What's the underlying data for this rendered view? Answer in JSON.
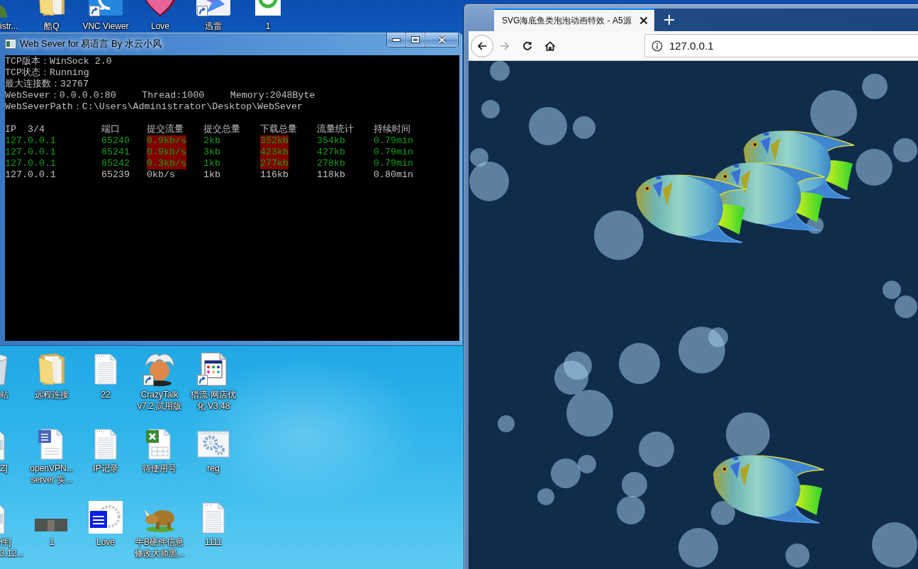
{
  "desktop": {
    "icons": [
      {
        "label": "istr...",
        "kind": "user",
        "shortcut": false
      },
      {
        "label": "酷Q",
        "kind": "folder",
        "shortcut": false
      },
      {
        "label": "VNC Viewer",
        "kind": "vnc",
        "shortcut": true
      },
      {
        "label": "Love",
        "kind": "heart",
        "shortcut": false
      },
      {
        "label": "迅雷",
        "kind": "bird",
        "shortcut": true
      },
      {
        "label": "1",
        "kind": "ring",
        "shortcut": false
      },
      {
        "label": "站",
        "kind": "bin",
        "shortcut": false
      },
      {
        "label": "远程连接",
        "kind": "folder",
        "shortcut": false
      },
      {
        "label": "22",
        "kind": "text",
        "shortcut": false
      },
      {
        "label": "CrazyTalk\nv7.2 試用版",
        "kind": "character",
        "shortcut": true
      },
      {
        "label": "猎流-网店优化 V3.48",
        "kind": "app",
        "shortcut": true
      },
      {
        "label": "Z]",
        "kind": "file",
        "shortcut": false
      },
      {
        "label": "openVPN...\nserver 实...",
        "kind": "word",
        "shortcut": false
      },
      {
        "label": "IP记录",
        "kind": "text",
        "shortcut": false
      },
      {
        "label": "待使用号",
        "kind": "sheet",
        "shortcut": false
      },
      {
        "label": "reg",
        "kind": "gear",
        "shortcut": false
      },
      {
        "label": "件]\n3.12...",
        "kind": "file",
        "shortcut": false
      },
      {
        "label": "1",
        "kind": "photo",
        "shortcut": false
      },
      {
        "label": "Love",
        "kind": "tile",
        "shortcut": false
      },
      {
        "label": "牛B硬件信息修改大师黑...",
        "kind": "animal",
        "shortcut": false
      },
      {
        "label": "1111",
        "kind": "text",
        "shortcut": false
      }
    ]
  },
  "console_window": {
    "title": "Web Sever for 易语言 By 水云小风",
    "lines": [
      [
        "TCP版本：WinSock 2.0"
      ],
      [
        "TCP状态：Running"
      ],
      [
        "最大连接数：32767"
      ],
      [
        "WebSever：0.0.0.0:80",
        "Thread:1000",
        "Memory:2048Byte"
      ],
      [
        "WebSeverPath：C:\\Users\\Administrator\\Desktop\\WebSever"
      ]
    ],
    "columns": [
      {
        "label": "IP  3/4",
        "highlight": false
      },
      {
        "label": "端口",
        "highlight": false
      },
      {
        "label": "提交流量",
        "highlight": true
      },
      {
        "label": "提交总量",
        "highlight": false
      },
      {
        "label": "下载总量",
        "highlight": true
      },
      {
        "label": "流量统计",
        "highlight": false
      },
      {
        "label": "持续时间",
        "highlight": false
      }
    ],
    "rows": [
      {
        "active": true,
        "cells": [
          "127.0.0.1",
          "65240",
          "0.9kb/s",
          "2kb",
          "352kb",
          "354kb",
          "0.79min"
        ]
      },
      {
        "active": true,
        "cells": [
          "127.0.0.1",
          "65241",
          "0.9kb/s",
          "3kb",
          "423kb",
          "427kb",
          "0.79min"
        ]
      },
      {
        "active": true,
        "cells": [
          "127.0.0.1",
          "65242",
          "0.3kb/s",
          "1kb",
          "277kb",
          "278kb",
          "0.79min"
        ]
      },
      {
        "active": false,
        "cells": [
          "127.0.0.1",
          "65239",
          "0kb/s",
          "1kb",
          "116kb",
          "118kb",
          "0.80min"
        ]
      }
    ]
  },
  "browser_window": {
    "tabs": [
      {
        "title": "SVG海底鱼类泡泡动画特效 - A5源",
        "selected": true
      }
    ],
    "toolbar_buttons": [
      {
        "kind": "back",
        "disabled": false
      },
      {
        "kind": "forward",
        "disabled": true
      },
      {
        "kind": "reload",
        "disabled": false
      },
      {
        "kind": "home",
        "disabled": false
      }
    ],
    "url": "127.0.0.1"
  }
}
